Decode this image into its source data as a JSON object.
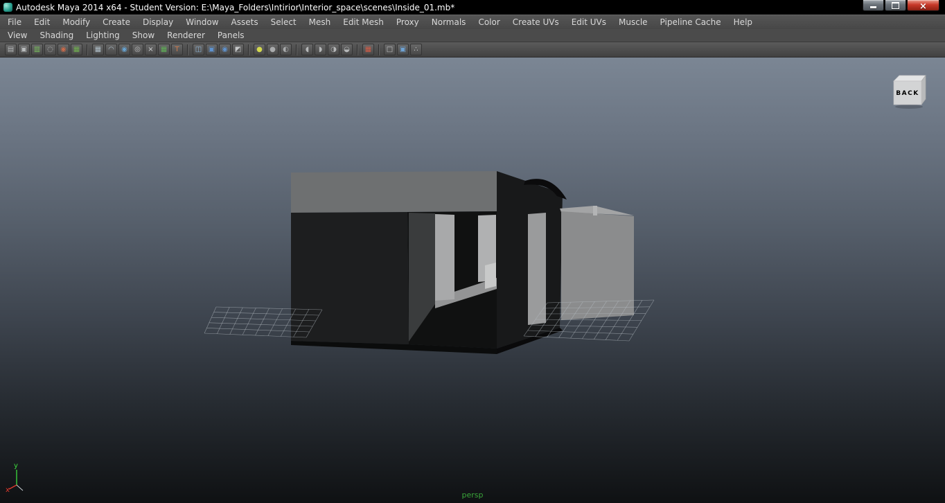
{
  "window": {
    "title": "Autodesk Maya 2014 x64 - Student Version: E:\\Maya_Folders\\Intirior\\Interior_space\\scenes\\Inside_01.mb*",
    "controls": [
      "minimize",
      "maximize",
      "close"
    ]
  },
  "menu_bar": {
    "items": [
      "File",
      "Edit",
      "Modify",
      "Create",
      "Display",
      "Window",
      "Assets",
      "Select",
      "Mesh",
      "Edit Mesh",
      "Proxy",
      "Normals",
      "Color",
      "Create UVs",
      "Edit UVs",
      "Muscle",
      "Pipeline Cache",
      "Help"
    ]
  },
  "panel_menu_bar": {
    "items": [
      "View",
      "Shading",
      "Lighting",
      "Show",
      "Renderer",
      "Panels"
    ]
  },
  "toolbar": {
    "icons": [
      {
        "name": "scene-hierarchy-icon",
        "glyph": "▤",
        "color": "#b9bcbd"
      },
      {
        "name": "object-selection-mask-icon",
        "glyph": "▣",
        "color": "#b9bcbd"
      },
      {
        "name": "histogram-icon",
        "glyph": "▥",
        "color": "#79c15c"
      },
      {
        "name": "lasso-tool-icon",
        "glyph": "◌",
        "color": "#c2c4c5"
      },
      {
        "name": "paint-select-icon",
        "glyph": "◉",
        "color": "#c96a4a"
      },
      {
        "name": "quick-select-set-icon",
        "glyph": "▦",
        "color": "#6fae4f"
      },
      {
        "divider": true
      },
      {
        "name": "snap-to-grids-icon",
        "glyph": "▦",
        "color": "#aebdc6"
      },
      {
        "name": "snap-to-curves-icon",
        "glyph": "◠",
        "color": "#aebdc6"
      },
      {
        "name": "snap-to-points-icon",
        "glyph": "◉",
        "color": "#66a3d2"
      },
      {
        "name": "snap-to-projected-center-icon",
        "glyph": "◎",
        "color": "#c0c2c3"
      },
      {
        "name": "snap-to-view-planes-icon",
        "glyph": "×",
        "color": "#d0d2d3"
      },
      {
        "name": "make-object-live-icon",
        "glyph": "▦",
        "color": "#5fae57"
      },
      {
        "name": "snap-together-tool-icon",
        "glyph": "T",
        "color": "#cd7a4d"
      },
      {
        "divider": true
      },
      {
        "name": "input-connections-icon",
        "glyph": "◫",
        "color": "#8fb6d8"
      },
      {
        "name": "construction-history-icon",
        "glyph": "▣",
        "color": "#5f93cf"
      },
      {
        "name": "output-connections-icon",
        "glyph": "◉",
        "color": "#5f93cf"
      },
      {
        "name": "transparency-display-icon",
        "glyph": "◩",
        "color": "#c6c8c9"
      },
      {
        "divider": true
      },
      {
        "name": "render-current-frame-icon",
        "glyph": "●",
        "color": "#d3d94e"
      },
      {
        "name": "ipr-render-icon",
        "glyph": "●",
        "color": "#a9abac"
      },
      {
        "name": "render-settings-icon",
        "glyph": "◐",
        "color": "#a9abac"
      },
      {
        "divider": true
      },
      {
        "name": "default-lighting-icon",
        "glyph": "◖",
        "color": "#b5b7b8"
      },
      {
        "name": "all-lights-icon",
        "glyph": "◗",
        "color": "#b5b7b8"
      },
      {
        "name": "shadows-display-icon",
        "glyph": "◑",
        "color": "#b5b7b8"
      },
      {
        "name": "textures-display-icon",
        "glyph": "◒",
        "color": "#b5b7b8"
      },
      {
        "divider": true
      },
      {
        "name": "grid-select-icon",
        "glyph": "▦",
        "color": "#cf5b46"
      },
      {
        "divider": true
      },
      {
        "name": "isolate-select-icon",
        "glyph": "□",
        "color": "#c3c5c6"
      },
      {
        "name": "wireframe-on-shaded-icon",
        "glyph": "▣",
        "color": "#6fa3d4"
      },
      {
        "name": "share-nodes-icon",
        "glyph": "∴",
        "color": "#c3c5c6"
      }
    ]
  },
  "viewport": {
    "camera_label": "persp",
    "view_cube_label": "BACK",
    "axis": {
      "x_label": "x",
      "y_label": "y",
      "x_color": "#e0392c",
      "y_color": "#3ddd3d"
    },
    "colors": {
      "background_top": "#7b8694",
      "background_bottom": "#0f1113",
      "grid_line": "#b6bdc3",
      "camera_label_color": "#39a539",
      "roof": "#6e7071",
      "dark_wall": "#1d1e1f",
      "light_box": "#8b8c8d"
    }
  }
}
